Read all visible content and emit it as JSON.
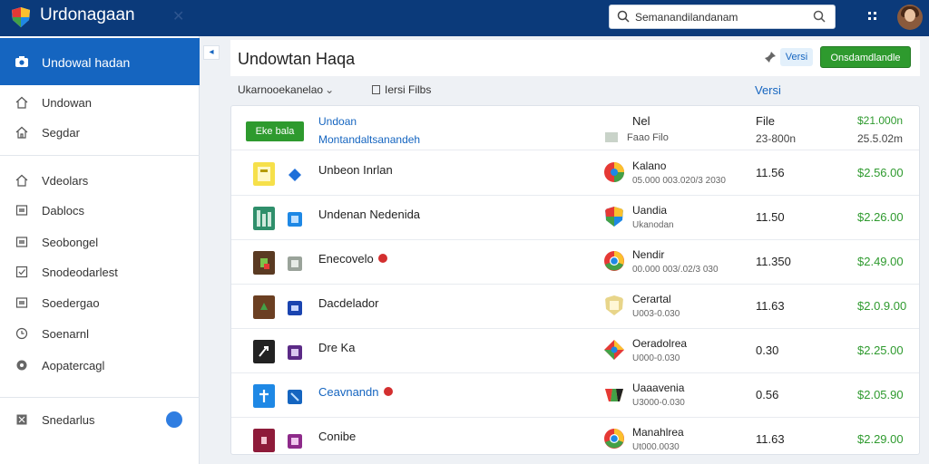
{
  "topbar": {
    "title": "Urdonagaan",
    "search_value": "Semanandilandanam"
  },
  "sidebar": {
    "active": "Undowal hadan",
    "items": [
      {
        "label": "Undowan",
        "icon": "home-icon"
      },
      {
        "label": "Segdar",
        "icon": "store-icon"
      },
      {
        "label": "Vdeolars",
        "icon": "home-icon"
      },
      {
        "label": "Dablocs",
        "icon": "window-icon"
      },
      {
        "label": "Seobongel",
        "icon": "window-icon"
      },
      {
        "label": "Snodeodarlest",
        "icon": "check-icon"
      },
      {
        "label": "Soedergao",
        "icon": "window-icon"
      },
      {
        "label": "Soenarnl",
        "icon": "clock-icon"
      },
      {
        "label": "Aopatercagl",
        "icon": "settings-icon"
      },
      {
        "label": "Snedarlus",
        "icon": "grid-icon"
      }
    ]
  },
  "main": {
    "title": "Undowtan Haqa",
    "version_chip": "Versi",
    "action_button": "Onsdamdlandle",
    "filter_one": "Ukarnooekanelao",
    "filter_two": "Iersi Filbs",
    "versi_link": "Versi"
  },
  "header_row": {
    "button": "Eke bala",
    "line1": "Undoan",
    "line2": "Montandaltsanandeh",
    "col1_top": "Nel",
    "col1_bottom": "Faao Filo",
    "col2_top": "File",
    "col2_bottom": "23-800n",
    "col3_top": "$21.000n",
    "col3_bottom": "25.5.02m"
  },
  "rows": [
    {
      "name": "Unbeon Inrlan",
      "badge": false,
      "blue": false,
      "publisher": "Kalano",
      "sub": "05.000 003.020/3 2030",
      "version": "11.56",
      "price": "$2.56.00"
    },
    {
      "name": "Undenan Nedenida",
      "badge": false,
      "blue": false,
      "publisher": "Uandia",
      "sub": "Ukanodan",
      "version": "11.50",
      "price": "$2.26.00"
    },
    {
      "name": "Enecovelo",
      "badge": true,
      "blue": false,
      "publisher": "Nendir",
      "sub": "00.000 003/.02/3 030",
      "version": "11.350",
      "price": "$2.49.00"
    },
    {
      "name": "Dacdelador",
      "badge": false,
      "blue": false,
      "publisher": "Cerartal",
      "sub": "U003-0.030",
      "version": "11.63",
      "price": "$2.0.9.00"
    },
    {
      "name": "Dre Ka",
      "badge": false,
      "blue": false,
      "publisher": "Oeradolrea",
      "sub": "U000-0.030",
      "version": "0.30",
      "price": "$2.25.00"
    },
    {
      "name": "Ceavnandn",
      "badge": true,
      "blue": true,
      "publisher": "Uaaavenia",
      "sub": "U3000-0.030",
      "version": "0.56",
      "price": "$2.05.90"
    },
    {
      "name": "Conibe",
      "badge": false,
      "blue": false,
      "publisher": "Manahlrea",
      "sub": "Ut000.0030",
      "version": "11.63",
      "price": "$2.29.00"
    }
  ]
}
